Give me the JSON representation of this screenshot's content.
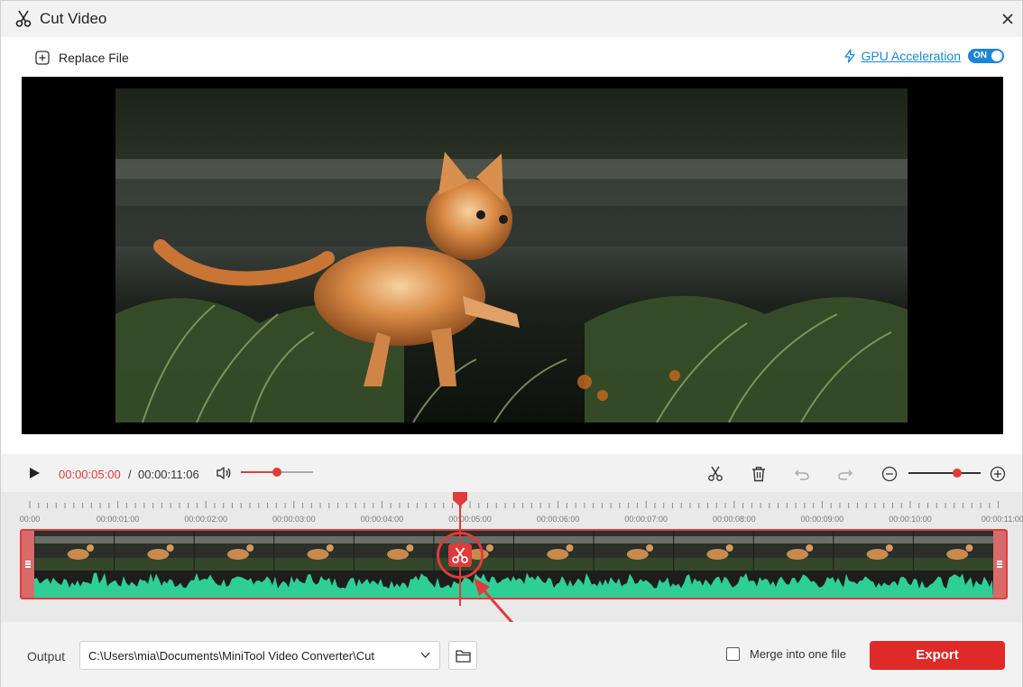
{
  "window": {
    "title": "Cut Video"
  },
  "topbar": {
    "replace_label": "Replace File",
    "gpu_label": "GPU Acceleration",
    "gpu_toggle": "ON"
  },
  "player": {
    "current_time": "00:00:05:00",
    "separator": "/",
    "total_time": "00:00:11:06",
    "volume_level": 0.5,
    "zoom_level": 0.68
  },
  "timeline": {
    "ticks": [
      "00:00",
      "00:00:01:00",
      "00:00:02:00",
      "00:00:03:00",
      "00:00:04:00",
      "00:00:05:00",
      "00:00:06:00",
      "00:00:07:00",
      "00:00:08:00",
      "00:00:09:00",
      "00:00:10:00",
      "00:00:11:00"
    ],
    "playhead_seconds": 5
  },
  "bottom": {
    "output_label": "Output",
    "output_path": "C:\\Users\\mia\\Documents\\MiniTool Video Converter\\Cut",
    "merge_label": "Merge into one file",
    "merge_checked": false,
    "export_label": "Export"
  },
  "colors": {
    "accent": "#e03b3b",
    "export": "#e02a2a",
    "link": "#1a86d8",
    "waveform": "#2ecf96"
  }
}
